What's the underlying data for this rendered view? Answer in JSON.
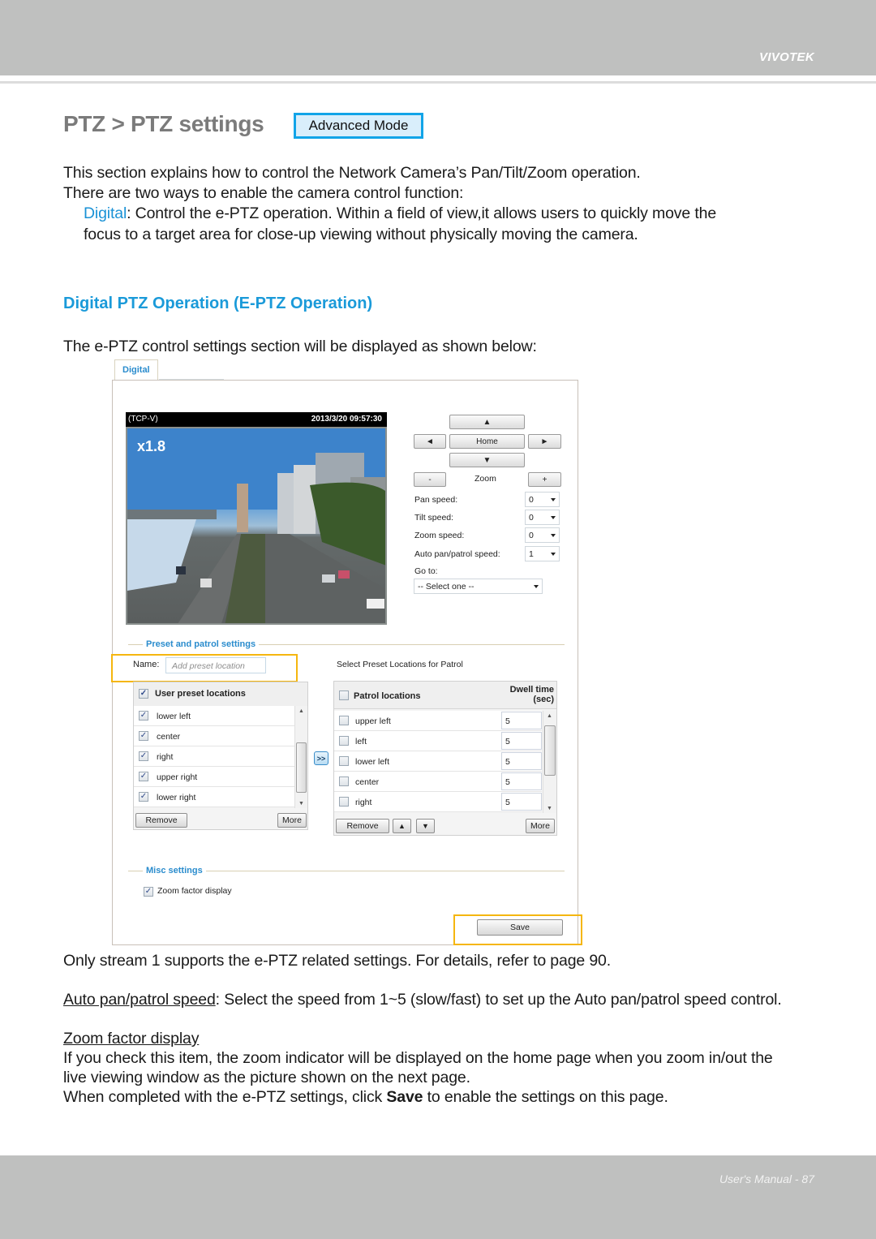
{
  "header": {
    "brand": "VIVOTEK"
  },
  "footer": {
    "page_label": "User's Manual - 87"
  },
  "title": {
    "text": "PTZ > PTZ settings",
    "badge": "Advanced Mode"
  },
  "intro": {
    "line1": "This section explains how to control the Network Camera’s Pan/Tilt/Zoom operation.",
    "line2": "There are two ways to enable the camera control function:",
    "digital_term": "Digital",
    "digital_desc1": ": Control the e-PTZ operation. Within a field of view,it allows users to quickly move the",
    "digital_desc2": "focus to a target area for close-up viewing without physically moving the camera."
  },
  "section": {
    "heading": "Digital PTZ Operation (E-PTZ Operation)",
    "lead": "The e-PTZ control settings section will be displayed as shown below:"
  },
  "ui": {
    "tab": "Digital",
    "video": {
      "stream": "(TCP-V)",
      "timestamp": "2013/3/20 09:57:30",
      "zoom_factor": "x1.8"
    },
    "controls": {
      "up": "▲",
      "left": "◄",
      "home": "Home",
      "right": "►",
      "down": "▼",
      "zoom_out": "-",
      "zoom_label": "Zoom",
      "zoom_in": "+",
      "pan_speed_label": "Pan speed:",
      "pan_speed": "0",
      "tilt_speed_label": "Tilt speed:",
      "tilt_speed": "0",
      "zoom_speed_label": "Zoom speed:",
      "zoom_speed": "0",
      "auto_speed_label": "Auto pan/patrol speed:",
      "auto_speed": "1",
      "goto_label": "Go to:",
      "goto_value": "-- Select one --"
    },
    "preset": {
      "legend": "Preset and patrol settings",
      "name_label": "Name:",
      "name_placeholder": "Add preset location",
      "user_header": "User preset locations",
      "user_items": [
        "lower left",
        "center",
        "right",
        "upper right",
        "lower right"
      ],
      "remove": "Remove",
      "more": "More",
      "transfer": ">>",
      "patrol_caption": "Select Preset Locations for Patrol",
      "patrol_header": "Patrol locations",
      "dwell_header1": "Dwell time",
      "dwell_header2": "(sec)",
      "patrol_items": [
        {
          "name": "upper left",
          "dwell": "5"
        },
        {
          "name": "left",
          "dwell": "5"
        },
        {
          "name": "lower left",
          "dwell": "5"
        },
        {
          "name": "center",
          "dwell": "5"
        },
        {
          "name": "right",
          "dwell": "5"
        }
      ],
      "patrol_remove": "Remove",
      "patrol_up": "▲",
      "patrol_down": "▼",
      "patrol_more": "More"
    },
    "misc": {
      "legend": "Misc settings",
      "zoom_display": "Zoom factor display",
      "zoom_display_checked": true
    },
    "save": "Save"
  },
  "notes": {
    "stream_note": "Only stream 1 supports the e-PTZ related settings. For details, refer to page 90.",
    "auto_term": "Auto pan/patrol speed",
    "auto_desc": ": Select the speed from 1~5 (slow/fast) to set up the Auto pan/patrol speed control.",
    "zoom_term": "Zoom factor display",
    "zoom_desc1": "If you check this item, the zoom indicator will be displayed on the home page when you zoom in/out the",
    "zoom_desc2": "live viewing window as the picture shown on the next page.",
    "save_pre": "When completed with the e-PTZ settings, click ",
    "save_word": "Save",
    "save_post": " to enable the settings on this page."
  },
  "colors": {
    "accent_blue": "#1a92d6",
    "highlight": "#f5b60f",
    "badge_border": "#11a4e8",
    "band_gray": "#bfc0bf"
  }
}
